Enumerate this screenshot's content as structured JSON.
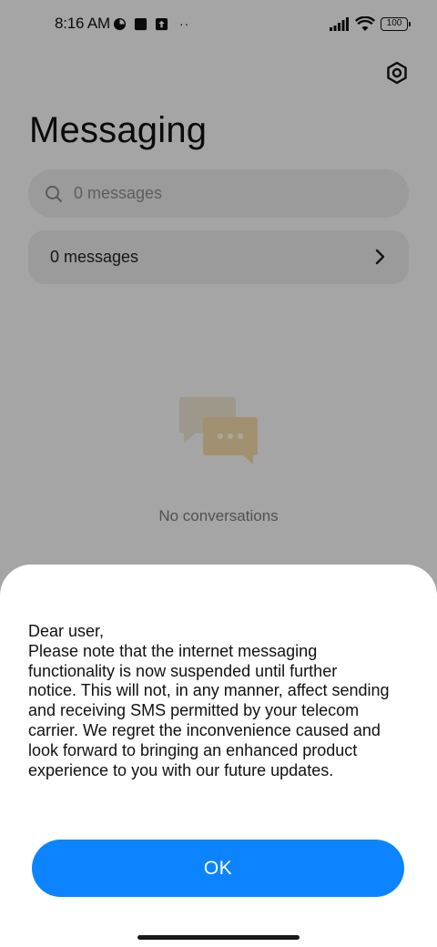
{
  "status_bar": {
    "time": "8:16 AM",
    "battery": "100",
    "dots": "··"
  },
  "header": {
    "title": "Messaging"
  },
  "search": {
    "placeholder": "0 messages"
  },
  "messages_row": {
    "label": "0 messages"
  },
  "empty_state": {
    "text": "No conversations"
  },
  "dialog": {
    "lines": [
      "Dear user,",
      "Please note that the internet messaging",
      "functionality is now suspended until further",
      "notice. This will not, in any manner, affect sending",
      "and receiving SMS permitted by your telecom",
      "carrier. We regret the inconvenience caused and",
      "look forward to bringing an enhanced product",
      "experience to you with our future updates."
    ],
    "ok_label": "OK"
  },
  "colors": {
    "accent": "#0d84ff",
    "overlay": "rgba(0,0,0,0.33)"
  }
}
